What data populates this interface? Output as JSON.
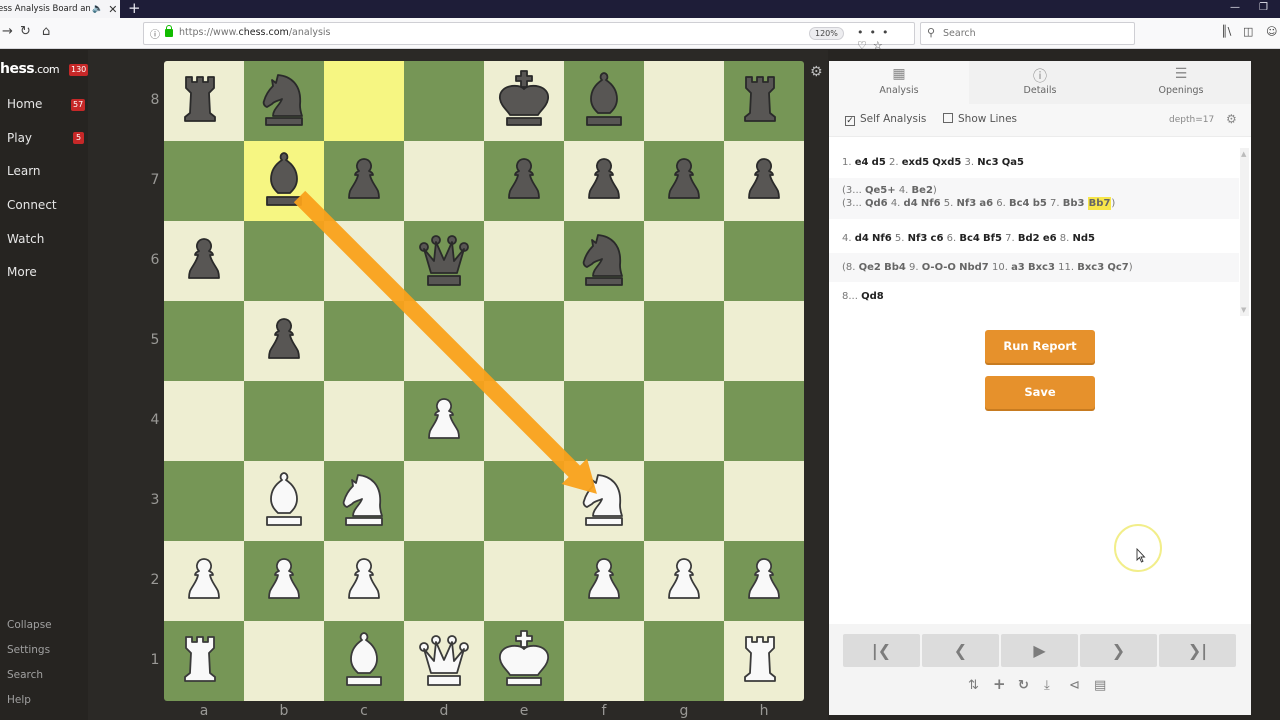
{
  "browser": {
    "tab_title": "ess Analysis Board and P",
    "tab_sound_icon": "speaker-icon",
    "url_host_prefix": "https://www.",
    "url_host": "chess.com",
    "url_path": "/analysis",
    "zoom": "120%",
    "search_placeholder": "Search"
  },
  "sidebar": {
    "logo_main": "hess",
    "logo_suffix": ".com",
    "logo_badge": "130",
    "items": [
      {
        "label": "Home",
        "badge": "57"
      },
      {
        "label": "Play",
        "badge": "5"
      },
      {
        "label": "Learn"
      },
      {
        "label": "Connect"
      },
      {
        "label": "Watch"
      },
      {
        "label": "More"
      }
    ],
    "bottom_items": [
      "Collapse",
      "Settings",
      "Search",
      "Help"
    ]
  },
  "board": {
    "ranks": [
      "8",
      "7",
      "6",
      "5",
      "4",
      "3",
      "2",
      "1"
    ],
    "files": [
      "a",
      "b",
      "c",
      "d",
      "e",
      "f",
      "g",
      "h"
    ],
    "position": [
      [
        "bR",
        "bN",
        "",
        "",
        "bK",
        "bB",
        "",
        "bR"
      ],
      [
        "",
        "bB",
        "bP",
        "",
        "bP",
        "bP",
        "bP",
        "bP"
      ],
      [
        "bP",
        "",
        "",
        "bQ",
        "",
        "bN",
        "",
        ""
      ],
      [
        "",
        "bP",
        "",
        "",
        "",
        "",
        "",
        ""
      ],
      [
        "",
        "",
        "",
        "wP",
        "",
        "",
        "",
        ""
      ],
      [
        "",
        "wB",
        "wN",
        "",
        "",
        "wN",
        "",
        ""
      ],
      [
        "wP",
        "wP",
        "wP",
        "",
        "",
        "wP",
        "wP",
        "wP"
      ],
      [
        "wR",
        "",
        "wB",
        "wQ",
        "wK",
        "",
        "",
        "wR"
      ]
    ],
    "highlighted_squares": [
      "c8",
      "b7"
    ],
    "arrow": {
      "from": "b7",
      "to": "f3",
      "color": "#f9a11b"
    },
    "colors": {
      "light": "#eeeed2",
      "dark": "#769656",
      "highlight": "#f6f682"
    }
  },
  "panel": {
    "tabs": [
      {
        "label": "Analysis",
        "icon": "analysis-board-icon",
        "active": true
      },
      {
        "label": "Details",
        "icon": "info-icon",
        "active": false
      },
      {
        "label": "Openings",
        "icon": "book-stack-icon",
        "active": false
      }
    ],
    "self_analysis_label": "Self Analysis",
    "self_analysis_checked": true,
    "show_lines_label": "Show Lines",
    "show_lines_checked": false,
    "depth": "depth=17",
    "move_lines": [
      {
        "type": "main",
        "tokens": [
          [
            "n",
            "1."
          ],
          [
            "m",
            "e4"
          ],
          [
            "m",
            "d5"
          ],
          [
            "n",
            "2."
          ],
          [
            "m",
            "exd5"
          ],
          [
            "m",
            "Qxd5"
          ],
          [
            "n",
            "3."
          ],
          [
            "m",
            "Nc3"
          ],
          [
            "m",
            "Qa5"
          ]
        ]
      },
      {
        "type": "var",
        "tokens": [
          [
            "n",
            "(3..."
          ],
          [
            "m",
            "Qe5+"
          ],
          [
            "n",
            "4."
          ],
          [
            "m",
            "Be2"
          ],
          [
            "n",
            ")"
          ]
        ]
      },
      {
        "type": "var",
        "tokens": [
          [
            "n",
            "(3..."
          ],
          [
            "m",
            "Qd6"
          ],
          [
            "n",
            "4."
          ],
          [
            "m",
            "d4"
          ],
          [
            "m",
            "Nf6"
          ],
          [
            "n",
            "5."
          ],
          [
            "m",
            "Nf3"
          ],
          [
            "m",
            "a6"
          ],
          [
            "n",
            "6."
          ],
          [
            "m",
            "Bc4"
          ],
          [
            "m",
            "b5"
          ],
          [
            "n",
            "7."
          ],
          [
            "m",
            "Bb3"
          ],
          [
            "c",
            "Bb7"
          ],
          [
            "n",
            ")"
          ]
        ]
      },
      {
        "type": "main",
        "tokens": [
          [
            "n",
            "4."
          ],
          [
            "m",
            "d4"
          ],
          [
            "m",
            "Nf6"
          ],
          [
            "n",
            "5."
          ],
          [
            "m",
            "Nf3"
          ],
          [
            "m",
            "c6"
          ],
          [
            "n",
            "6."
          ],
          [
            "m",
            "Bc4"
          ],
          [
            "m",
            "Bf5"
          ],
          [
            "n",
            "7."
          ],
          [
            "m",
            "Bd2"
          ],
          [
            "m",
            "e6"
          ],
          [
            "n",
            "8."
          ],
          [
            "m",
            "Nd5"
          ]
        ]
      },
      {
        "type": "var",
        "tokens": [
          [
            "n",
            "(8."
          ],
          [
            "m",
            "Qe2"
          ],
          [
            "m",
            "Bb4"
          ],
          [
            "n",
            "9."
          ],
          [
            "m",
            "O-O-O"
          ],
          [
            "m",
            "Nbd7"
          ],
          [
            "n",
            "10."
          ],
          [
            "m",
            "a3"
          ],
          [
            "m",
            "Bxc3"
          ],
          [
            "n",
            "11."
          ],
          [
            "m",
            "Bxc3"
          ],
          [
            "m",
            "Qc7"
          ],
          [
            "n",
            ")"
          ]
        ]
      },
      {
        "type": "main",
        "tokens": [
          [
            "n",
            "8..."
          ],
          [
            "m",
            "Qd8"
          ]
        ]
      }
    ],
    "run_report_label": "Run Report",
    "save_label": "Save",
    "controls": [
      "first-move",
      "previous-move",
      "play",
      "next-move",
      "last-move"
    ],
    "tools": [
      "flip-board-icon",
      "add-icon",
      "reset-icon",
      "download-icon",
      "share-icon",
      "vs-computer-icon"
    ],
    "accent": "#e6912c"
  }
}
